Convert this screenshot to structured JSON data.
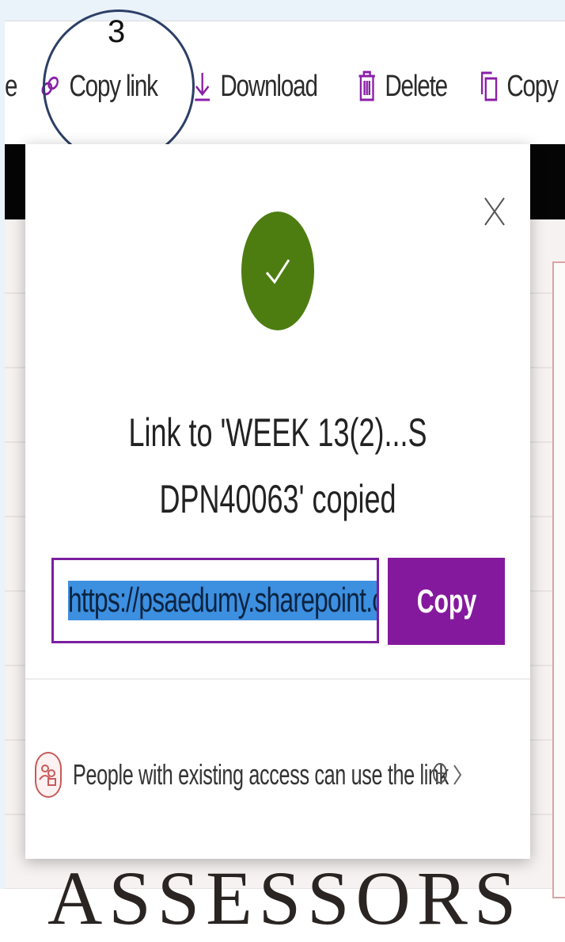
{
  "annotation": {
    "step_number": "3"
  },
  "toolbar": {
    "partial_left_label": "e",
    "copy_link_label": "Copy link",
    "download_label": "Download",
    "delete_label": "Delete",
    "copy_to_label": "Copy",
    "icons": [
      "link-icon",
      "download-icon",
      "trash-icon",
      "copy-icon"
    ]
  },
  "dialog": {
    "message_line1": "Link to 'WEEK 13(2)...S",
    "message_line2": "DPN40063' copied",
    "url_value": "https://psaedumy.sharepoint.co",
    "copy_button_label": "Copy",
    "access_text": "People with existing access can use the link",
    "colors": {
      "success": "#4d7d10",
      "accent": "#85199e",
      "selection": "#3d8fe0"
    }
  },
  "background": {
    "doc_heading": "ASSESSORS"
  }
}
